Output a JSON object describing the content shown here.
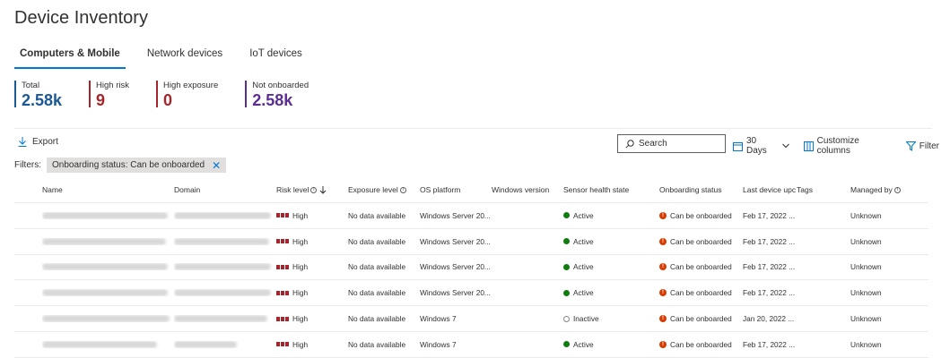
{
  "page_title": "Device Inventory",
  "tabs": [
    {
      "label": "Computers & Mobile",
      "active": true
    },
    {
      "label": "Network devices",
      "active": false
    },
    {
      "label": "IoT devices",
      "active": false
    }
  ],
  "metrics": [
    {
      "label": "Total",
      "value": "2.58k",
      "color": "#1b5894"
    },
    {
      "label": "High risk",
      "value": "9",
      "color": "#a4262c"
    },
    {
      "label": "High exposure",
      "value": "0",
      "color": "#a4262c"
    },
    {
      "label": "Not onboarded",
      "value": "2.58k",
      "color": "#5c2e91"
    }
  ],
  "toolbar": {
    "export_label": "Export",
    "search_placeholder": "Search",
    "timerange_label": "30 Days",
    "customize_label": "Customize columns",
    "filter_label": "Filter"
  },
  "filters": {
    "label": "Filters:",
    "chip_label": "Onboarding status: Can be onboarded"
  },
  "columns": [
    "Name",
    "Domain",
    "Risk level",
    "Exposure level",
    "OS platform",
    "Windows version",
    "Sensor health state",
    "Onboarding status",
    "Last device upc",
    "Tags",
    "Managed by"
  ],
  "rows": [
    {
      "risk": "High",
      "exposure": "No data available",
      "os": "Windows Server 20...",
      "version": "",
      "health": "Active",
      "onboarding": "Can be onboarded",
      "last_update": "Feb 17, 2022 ...",
      "tags": "",
      "managed_by": "Unknown"
    },
    {
      "risk": "High",
      "exposure": "No data available",
      "os": "Windows Server 20...",
      "version": "",
      "health": "Active",
      "onboarding": "Can be onboarded",
      "last_update": "Feb 17, 2022 ...",
      "tags": "",
      "managed_by": "Unknown"
    },
    {
      "risk": "High",
      "exposure": "No data available",
      "os": "Windows Server 20...",
      "version": "",
      "health": "Active",
      "onboarding": "Can be onboarded",
      "last_update": "Feb 17, 2022 ...",
      "tags": "",
      "managed_by": "Unknown"
    },
    {
      "risk": "High",
      "exposure": "No data available",
      "os": "Windows Server 20...",
      "version": "",
      "health": "Active",
      "onboarding": "Can be onboarded",
      "last_update": "Feb 17, 2022 ...",
      "tags": "",
      "managed_by": "Unknown"
    },
    {
      "risk": "High",
      "exposure": "No data available",
      "os": "Windows 7",
      "version": "",
      "health": "Inactive",
      "onboarding": "Can be onboarded",
      "last_update": "Jan 20, 2022 ...",
      "tags": "",
      "managed_by": "Unknown"
    },
    {
      "risk": "High",
      "exposure": "No data available",
      "os": "Windows 7",
      "version": "",
      "health": "Active",
      "onboarding": "Can be onboarded",
      "last_update": "Feb 17, 2022 ...",
      "tags": "",
      "managed_by": "Unknown"
    }
  ],
  "colors": {
    "accent": "#0078d4",
    "high_risk": "#a4262c",
    "active": "#107c10",
    "warning": "#d83b01"
  }
}
